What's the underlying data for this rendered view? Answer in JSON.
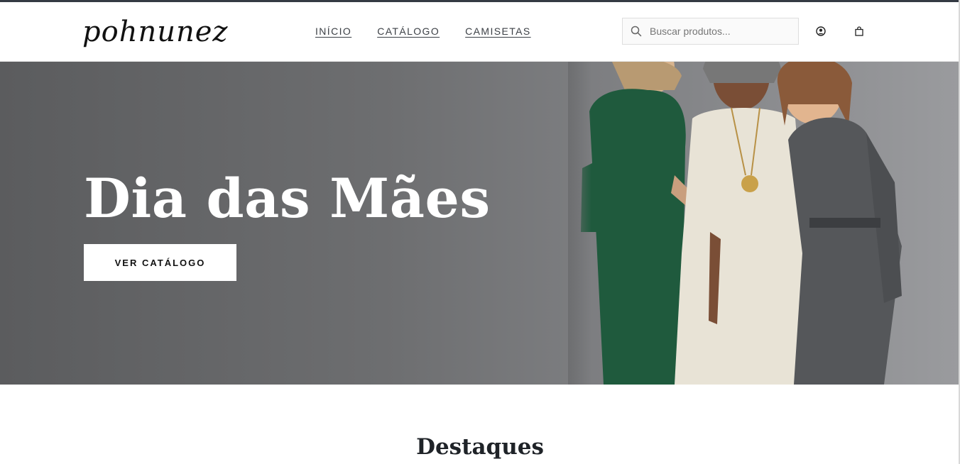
{
  "brand": {
    "logo_text": "pohnunez"
  },
  "nav": {
    "items": [
      {
        "label": "INÍCIO"
      },
      {
        "label": "CATÁLOGO"
      },
      {
        "label": "CAMISETAS"
      }
    ]
  },
  "search": {
    "placeholder": "Buscar produtos...",
    "icon": "search-icon"
  },
  "header_icons": {
    "account": "user-circle-icon",
    "cart": "shopping-bag-icon"
  },
  "hero": {
    "title": "Dia das Mães",
    "button_label": "VER CATÁLOGO",
    "image": "three-women-smiling-photo"
  },
  "featured": {
    "title": "Destaques"
  },
  "colors": {
    "header_bg": "#ffffff",
    "top_border": "#343a43",
    "hero_overlay": "#6d6e70",
    "button_bg": "#ffffff",
    "text_dark": "#1f2328"
  }
}
